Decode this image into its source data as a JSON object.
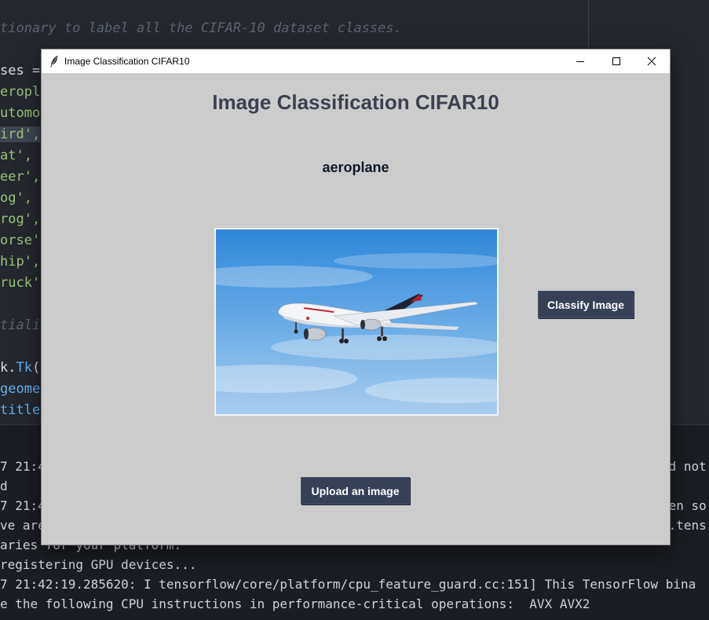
{
  "editor": {
    "lines": [
      {
        "text": "tionary to label all the CIFAR-10 dataset classes.",
        "style": "comment"
      },
      {
        "text": "ses = ",
        "style": "plain"
      },
      {
        "text": "eropla",
        "style": "str"
      },
      {
        "text": "utomob",
        "style": "str"
      },
      {
        "text": "ird',",
        "style": "str"
      },
      {
        "text": "at',",
        "style": "str"
      },
      {
        "text": "eer',",
        "style": "str"
      },
      {
        "text": "og',",
        "style": "str"
      },
      {
        "text": "rog',",
        "style": "str"
      },
      {
        "text": "orse',",
        "style": "str"
      },
      {
        "text": "hip',",
        "style": "str"
      },
      {
        "text": "ruck'",
        "style": "str"
      },
      {
        "text": "tialis",
        "style": "comment"
      },
      {
        "text_a": "k.",
        "text_b": "Tk",
        "text_c": "(",
        "style": "mixed"
      },
      {
        "text": "geomet",
        "style": "fn"
      },
      {
        "text_a": "title",
        "text_b": "(",
        "style": "mixed2"
      }
    ]
  },
  "terminal": {
    "lines": [
      "7 21:4",
      "d",
      "7 21:4",
      "ve are",
      "aries for your platform.",
      "registering GPU devices...",
      "7 21:42:19.285620: I tensorflow/core/platform/cpu_feature_guard.cc:151] This TensorFlow bina",
      "e the following CPU instructions in performance-critical operations:  AVX AVX2"
    ],
    "right_fragments": [
      "ld not",
      "pen so",
      "w.tens"
    ]
  },
  "window": {
    "title": "Image Classification CIFAR10",
    "heading": "Image Classification CIFAR10",
    "prediction": "aeroplane",
    "classify_label": "Classify Image",
    "upload_label": "Upload an image"
  },
  "colors": {
    "window_bg": "#cccccc",
    "button_bg": "#364156",
    "heading_color": "#3c4150",
    "prediction_color": "#10172a"
  },
  "icons": [
    "feather-icon",
    "minimize-icon",
    "maximize-icon",
    "close-icon"
  ]
}
